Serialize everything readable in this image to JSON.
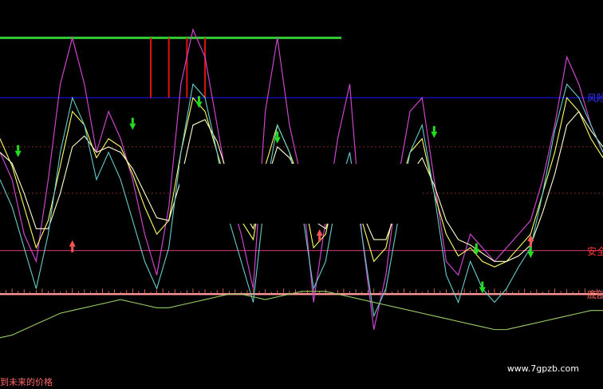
{
  "chart_data": {
    "type": "line",
    "title": "",
    "xlabel": "",
    "ylabel": "",
    "x": [
      0,
      2,
      4,
      6,
      8,
      10,
      12,
      14,
      16,
      18,
      20,
      22,
      24,
      26,
      28,
      30,
      32,
      34,
      36,
      38,
      40,
      42,
      44,
      46,
      48,
      50,
      52,
      54,
      56,
      58,
      60,
      62,
      64,
      66,
      68,
      70,
      72,
      74,
      76,
      78,
      80,
      82,
      84,
      86,
      88,
      90,
      92,
      94,
      96,
      98,
      100
    ],
    "ylim": [
      -8,
      120
    ],
    "grid": false,
    "colors": {
      "background": "#000000",
      "green_level": "#33cc33",
      "blue_level": "#1010c0",
      "magenta_level": "#b03060",
      "pink_level": "#ff9999",
      "dotted_level": "#7a2a2a",
      "red_bars": "#dd1111",
      "up_arrow": "#22dd22",
      "down_arrow": "#ff5555"
    },
    "levels": [
      {
        "name": "green-level",
        "y": 112,
        "color": "#33cc33"
      },
      {
        "name": "blue-level",
        "y": 90,
        "color": "#1010c0",
        "label": "风险"
      },
      {
        "name": "dotted-level-upper",
        "y": 72,
        "color": "#7a2a2a"
      },
      {
        "name": "dotted-level-lower",
        "y": 55,
        "color": "#7a2a2a"
      },
      {
        "name": "magenta-level",
        "y": 34,
        "color": "#b03060",
        "label": "安全"
      },
      {
        "name": "pink-level",
        "y": 18,
        "color": "#ff9999",
        "label": "底部"
      }
    ],
    "series": [
      {
        "color": "#cc44cc",
        "values": [
          70,
          60,
          40,
          30,
          60,
          95,
          112,
          95,
          70,
          85,
          75,
          60,
          40,
          25,
          50,
          95,
          115,
          105,
          80,
          55,
          40,
          20,
          85,
          112,
          80,
          60,
          15,
          45,
          75,
          95,
          40,
          5,
          25,
          60,
          85,
          90,
          60,
          30,
          25,
          40,
          35,
          30,
          35,
          40,
          45,
          60,
          80,
          105,
          95,
          80,
          70
        ]
      },
      {
        "color": "#ffff66",
        "values": [
          75,
          65,
          50,
          35,
          45,
          65,
          85,
          80,
          68,
          75,
          72,
          62,
          50,
          40,
          45,
          70,
          90,
          85,
          70,
          55,
          45,
          38,
          65,
          80,
          70,
          58,
          35,
          40,
          60,
          65,
          45,
          30,
          35,
          55,
          70,
          75,
          55,
          40,
          32,
          35,
          30,
          28,
          30,
          35,
          40,
          55,
          70,
          90,
          85,
          75,
          68
        ]
      },
      {
        "color": "#ffffcc",
        "values": [
          70,
          66,
          55,
          42,
          42,
          55,
          72,
          76,
          70,
          72,
          70,
          64,
          55,
          46,
          45,
          60,
          80,
          82,
          74,
          60,
          50,
          42,
          58,
          72,
          68,
          60,
          45,
          42,
          55,
          60,
          48,
          38,
          38,
          50,
          62,
          68,
          58,
          45,
          38,
          36,
          33,
          30,
          30,
          32,
          36,
          48,
          62,
          80,
          85,
          78,
          72
        ]
      },
      {
        "color": "#66cccc",
        "values": [
          60,
          50,
          35,
          20,
          40,
          70,
          90,
          80,
          60,
          70,
          60,
          45,
          30,
          20,
          35,
          70,
          95,
          90,
          70,
          45,
          30,
          15,
          55,
          80,
          70,
          50,
          20,
          30,
          55,
          70,
          40,
          10,
          20,
          45,
          70,
          80,
          55,
          25,
          15,
          30,
          20,
          15,
          20,
          28,
          35,
          55,
          78,
          95,
          90,
          80,
          70
        ]
      },
      {
        "color": "#99cc66",
        "values": [
          2,
          3,
          5,
          7,
          9,
          11,
          12,
          13,
          14,
          15,
          16,
          15,
          14,
          13,
          13,
          14,
          15,
          16,
          17,
          18,
          18,
          17,
          16,
          17,
          18,
          19,
          19,
          19,
          18,
          17,
          16,
          15,
          14,
          13,
          12,
          11,
          10,
          9,
          8,
          7,
          6,
          5,
          5,
          6,
          7,
          8,
          9,
          10,
          11,
          12,
          12
        ]
      }
    ],
    "sell_bars_x": [
      25,
      28,
      31,
      34
    ],
    "arrows_up": [
      [
        3,
        70
      ],
      [
        22,
        80
      ],
      [
        33,
        88
      ],
      [
        46,
        75
      ],
      [
        72,
        77
      ],
      [
        79,
        34
      ],
      [
        80,
        20
      ],
      [
        88,
        33
      ]
    ],
    "arrows_down": [
      [
        12,
        36
      ],
      [
        31,
        55
      ],
      [
        53,
        40
      ],
      [
        88,
        38
      ]
    ],
    "annotations": [
      "风险",
      "安全",
      "底部",
      "到未来的价格"
    ]
  },
  "overlay": {
    "watermark": "www.7gpzb.com"
  }
}
